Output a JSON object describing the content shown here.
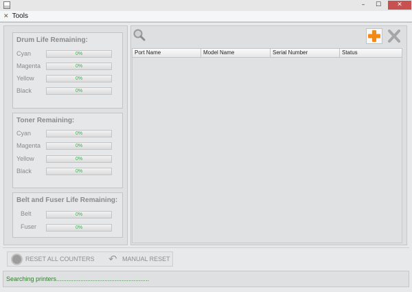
{
  "window": {
    "minimize": "–",
    "maximize": "☐",
    "close": "✕"
  },
  "menu": {
    "tools_icon": "✕",
    "tools": "Tools"
  },
  "drum": {
    "title": "Drum Life Remaining:",
    "rows": [
      {
        "label": "Cyan",
        "value": "0%"
      },
      {
        "label": "Magenta",
        "value": "0%"
      },
      {
        "label": "Yellow",
        "value": "0%"
      },
      {
        "label": "Black",
        "value": "0%"
      }
    ]
  },
  "toner": {
    "title": "Toner Remaining:",
    "rows": [
      {
        "label": "Cyan",
        "value": "0%"
      },
      {
        "label": "Magenta",
        "value": "0%"
      },
      {
        "label": "Yellow",
        "value": "0%"
      },
      {
        "label": "Black",
        "value": "0%"
      }
    ]
  },
  "belt": {
    "title": "Belt and Fuser Life Remaining:",
    "rows": [
      {
        "label": "Belt",
        "value": "0%"
      },
      {
        "label": "Fuser",
        "value": "0%"
      }
    ]
  },
  "toolbar": {
    "search_icon": "magnifier-icon",
    "add_icon": "plus-icon",
    "delete_icon": "x-icon"
  },
  "table": {
    "columns": [
      "Port Name",
      "Model Name",
      "Serial Number",
      "Status"
    ],
    "rows": []
  },
  "actions": {
    "reset_all": "RESET ALL COUNTERS",
    "manual_reset": "MANUAL RESET"
  },
  "status": {
    "text": "Searching printers......................................................"
  },
  "colors": {
    "percent_text": "#2fb24a",
    "add_icon": "#f28a1a",
    "status_text": "#2e7d2e"
  }
}
